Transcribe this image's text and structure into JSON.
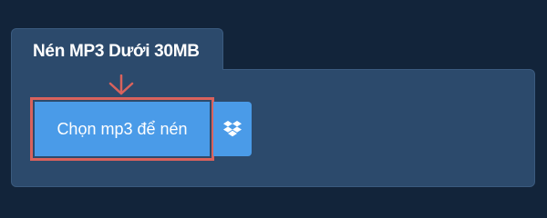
{
  "tab": {
    "title": "Nén MP3 Dưới 30MB"
  },
  "upload": {
    "choose_label": "Chọn mp3 để nén",
    "dropbox_icon": "dropbox-icon",
    "annotation_icon": "arrow-down-icon"
  },
  "colors": {
    "background": "#12243a",
    "panel": "#2c4a6c",
    "button": "#4a9be8",
    "highlight": "#d9625c"
  }
}
